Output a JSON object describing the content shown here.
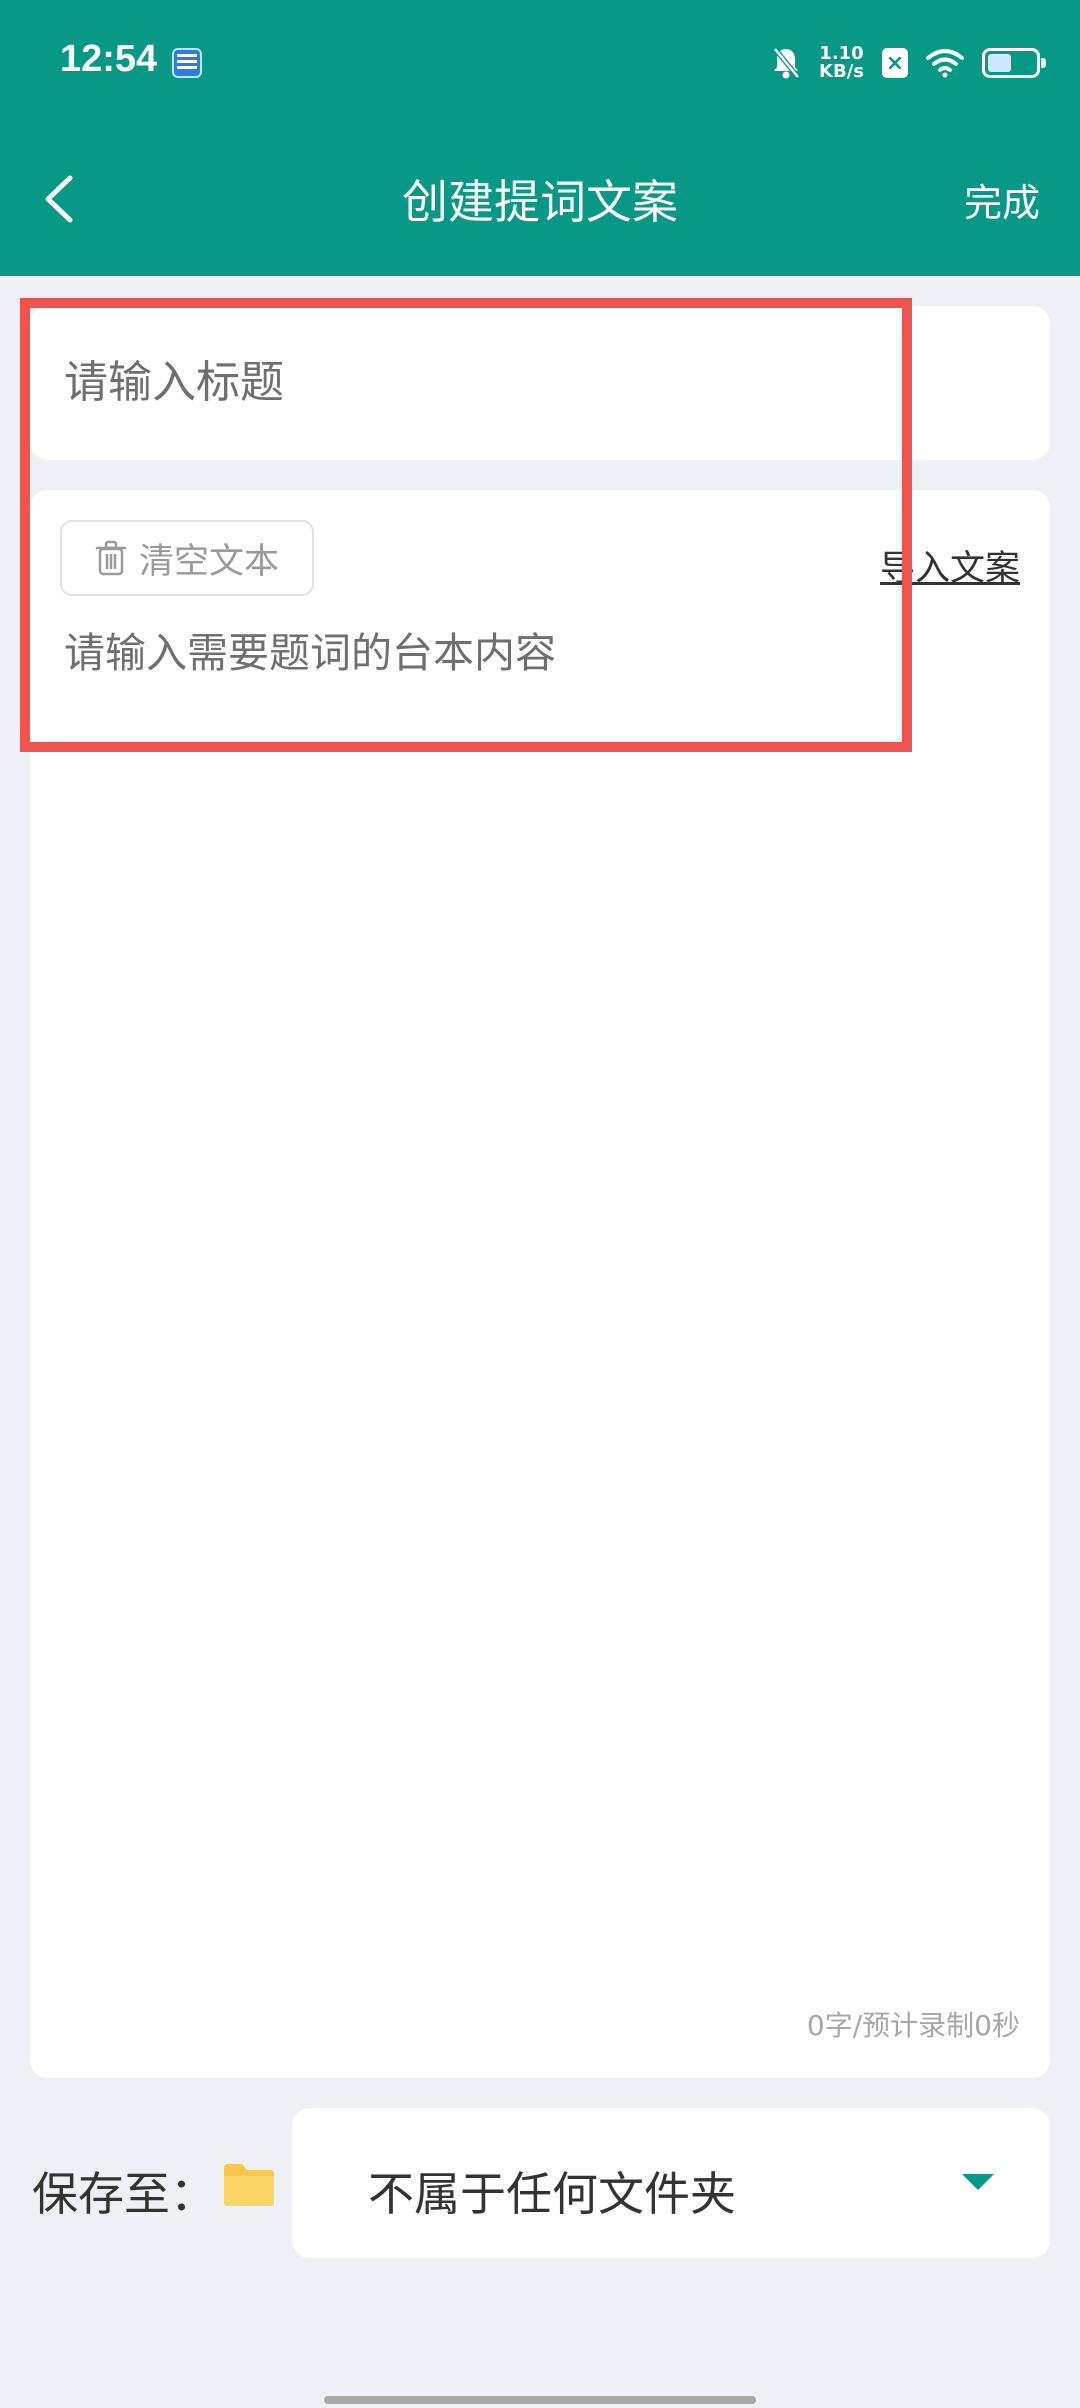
{
  "status_bar": {
    "time": "12:54",
    "net_speed_value": "1.10",
    "net_speed_unit": "KB/s",
    "sim_status": "×",
    "battery_level": 0.5
  },
  "nav": {
    "title": "创建提词文案",
    "done_label": "完成"
  },
  "title_field": {
    "placeholder": "请输入标题",
    "value": ""
  },
  "content": {
    "clear_label": "清空文本",
    "import_label": "导入文案",
    "placeholder": "请输入需要题词的台本内容",
    "value": "",
    "word_count": "0字/预计录制0秒"
  },
  "save": {
    "label": "保存至：",
    "folder_value": "不属于任何文件夹"
  },
  "colors": {
    "header": "#079886",
    "accent": "#079886",
    "highlight": "#ef5350",
    "folder": "#f8c84a"
  }
}
